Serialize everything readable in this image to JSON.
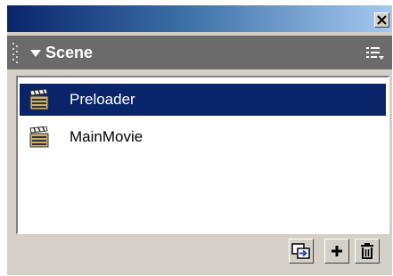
{
  "window": {
    "close_glyph": "×"
  },
  "panel": {
    "title": "Scene",
    "collapse_icon": "triangle-down",
    "options_icon": "list-menu-icon"
  },
  "scenes": [
    {
      "label": "Preloader",
      "selected": true,
      "icon": "clapperboard-icon"
    },
    {
      "label": "MainMovie",
      "selected": false,
      "icon": "clapperboard-icon"
    }
  ],
  "toolbar": {
    "buttons": [
      {
        "icon": "duplicate-scene-icon",
        "glyph": ""
      },
      {
        "icon": "add-scene-icon",
        "glyph": "+"
      },
      {
        "icon": "delete-scene-icon",
        "glyph": ""
      }
    ]
  },
  "colors": {
    "title_gradient_start": "#0a246a",
    "title_gradient_end": "#a6caf0",
    "header_bg": "#6b6b6b",
    "selection_bg": "#0a246a",
    "panel_bg": "#d4d0c8"
  }
}
